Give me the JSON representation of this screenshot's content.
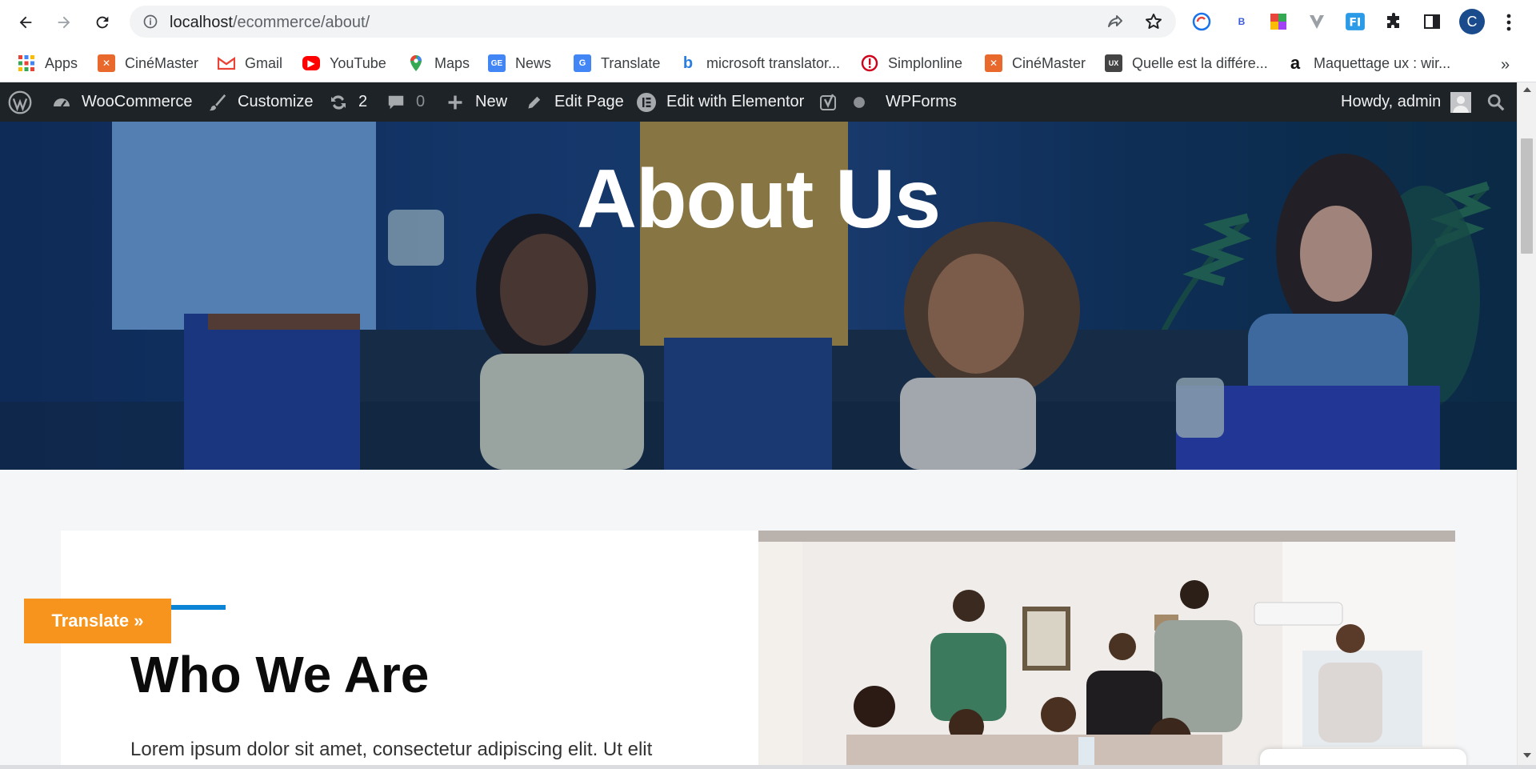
{
  "browser": {
    "url_host": "localhost",
    "url_path": "/ecommerce/about/",
    "profile_initial": "C",
    "extensions": [
      "translate-ext-icon",
      "b-ext-icon",
      "colorful-ext-icon",
      "v-ext-icon",
      "fi-ext-icon"
    ]
  },
  "bookmarks": [
    {
      "label": "Apps",
      "icon": "apps-grid-icon",
      "color": "#ea4335"
    },
    {
      "label": "CinéMaster",
      "icon": "xampp-icon",
      "color": "#e8692b"
    },
    {
      "label": "Gmail",
      "icon": "gmail-icon",
      "color": "#ea4335"
    },
    {
      "label": "YouTube",
      "icon": "youtube-icon",
      "color": "#ff0000"
    },
    {
      "label": "Maps",
      "icon": "maps-pin-icon",
      "color": "#34a853"
    },
    {
      "label": "News",
      "icon": "google-news-icon",
      "color": "#4285f4"
    },
    {
      "label": "Translate",
      "icon": "google-translate-icon",
      "color": "#4285f4"
    },
    {
      "label": "microsoft translator...",
      "icon": "bing-icon",
      "color": "#2a7de1"
    },
    {
      "label": "Simplonline",
      "icon": "simplonline-icon",
      "color": "#d0021b"
    },
    {
      "label": "CinéMaster",
      "icon": "xampp-icon",
      "color": "#e8692b"
    },
    {
      "label": "Quelle est la différe...",
      "icon": "blog-ux-icon",
      "color": "#444444"
    },
    {
      "label": "Maquettage ux : wir...",
      "icon": "amazon-icon",
      "color": "#111111"
    }
  ],
  "bookmarks_more": "»",
  "admin_bar": {
    "woocommerce": "WooCommerce",
    "customize": "Customize",
    "updates_count": "2",
    "comments_count": "0",
    "new": "New",
    "edit_page": "Edit Page",
    "elementor": "Edit with Elementor",
    "wpforms": "WPForms",
    "howdy": "Howdy, admin"
  },
  "hero": {
    "title": "About Us"
  },
  "about": {
    "heading": "Who We Are",
    "body": "Lorem ipsum dolor sit amet, consectetur adipiscing elit. Ut elit"
  },
  "translate_button": "Translate »",
  "colors": {
    "accent": "#0b84d6",
    "admin_bar_bg": "#1d2327",
    "translate_bg": "#f7941d"
  }
}
